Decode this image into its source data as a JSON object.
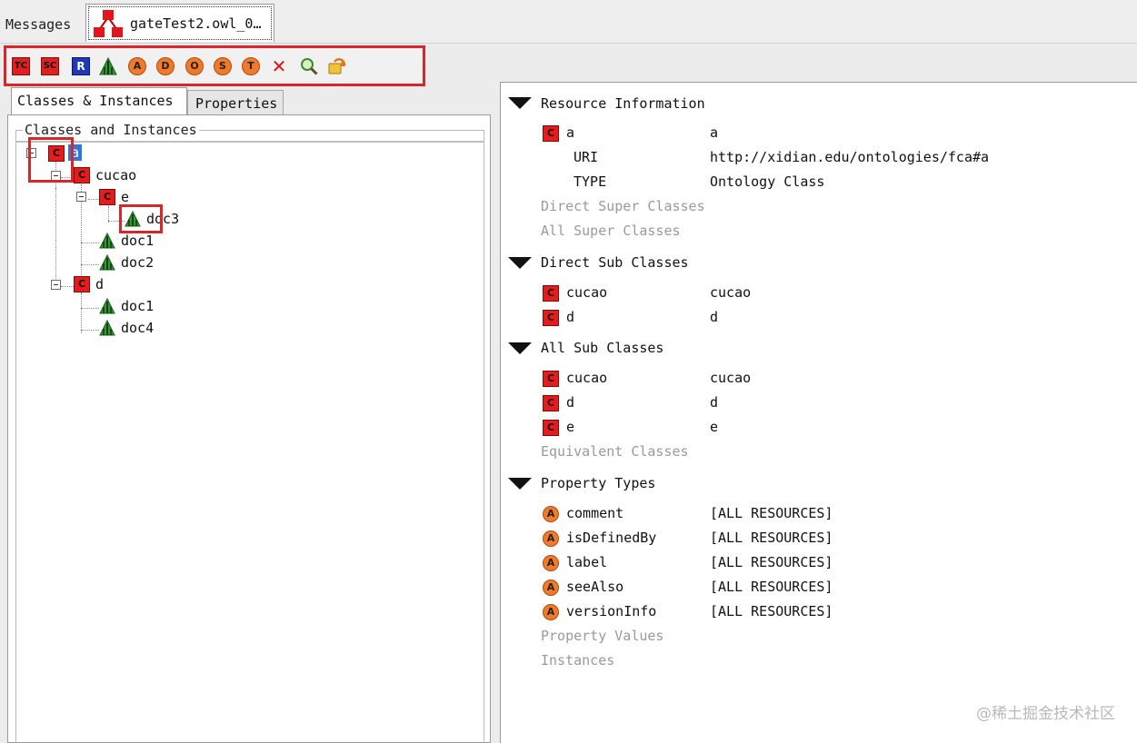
{
  "tabs": {
    "messages": "Messages",
    "gate": "gateTest2.owl_0…"
  },
  "toolbar": {
    "items": [
      {
        "name": "top-class-button",
        "glyph": "TC"
      },
      {
        "name": "sub-class-button",
        "glyph": "SC"
      },
      {
        "name": "restriction-button",
        "glyph": "R"
      },
      {
        "name": "instance-button",
        "glyph": ""
      },
      {
        "name": "annotation-property-button",
        "glyph": "A"
      },
      {
        "name": "datatype-property-button",
        "glyph": "D"
      },
      {
        "name": "object-property-button",
        "glyph": "O"
      },
      {
        "name": "symmetric-property-button",
        "glyph": "S"
      },
      {
        "name": "transitive-property-button",
        "glyph": "T"
      },
      {
        "name": "delete-button",
        "glyph": "✕"
      },
      {
        "name": "search-button",
        "glyph": ""
      },
      {
        "name": "refresh-button",
        "glyph": ""
      }
    ]
  },
  "left": {
    "tab_classes": "Classes & Instances",
    "tab_properties": "Properties",
    "group_title": "Classes and Instances",
    "tree": {
      "root": "a",
      "cucao": "cucao",
      "e": "e",
      "doc3": "doc3",
      "doc1a": "doc1",
      "doc2": "doc2",
      "d": "d",
      "doc1b": "doc1",
      "doc4": "doc4"
    }
  },
  "right": {
    "resource_info": {
      "title": "Resource Information",
      "name": "a",
      "name_val": "a",
      "uri_label": "URI",
      "uri_val": "http://xidian.edu/ontologies/fca#a",
      "type_label": "TYPE",
      "type_val": "Ontology Class",
      "direct_super": "Direct Super Classes",
      "all_super": "All Super Classes"
    },
    "direct_sub": {
      "title": "Direct Sub Classes",
      "rows": [
        {
          "name": "cucao",
          "val": "cucao"
        },
        {
          "name": "d",
          "val": "d"
        }
      ]
    },
    "all_sub": {
      "title": "All Sub Classes",
      "rows": [
        {
          "name": "cucao",
          "val": "cucao"
        },
        {
          "name": "d",
          "val": "d"
        },
        {
          "name": "e",
          "val": "e"
        }
      ],
      "equivalent": "Equivalent Classes"
    },
    "property_types": {
      "title": "Property Types",
      "rows": [
        {
          "name": "comment",
          "val": "[ALL RESOURCES]"
        },
        {
          "name": "isDefinedBy",
          "val": "[ALL RESOURCES]"
        },
        {
          "name": "label",
          "val": "[ALL RESOURCES]"
        },
        {
          "name": "seeAlso",
          "val": "[ALL RESOURCES]"
        },
        {
          "name": "versionInfo",
          "val": "[ALL RESOURCES]"
        }
      ],
      "property_values": "Property Values",
      "instances": "Instances"
    }
  },
  "icon_glyphs": {
    "class": "C",
    "annotation": "A"
  },
  "colors": {
    "highlight": "#d9262b",
    "class_icon": "#e41c1c",
    "annotation_icon": "#f07a2a",
    "selection": "#3377d6"
  },
  "watermark": "@稀土掘金技术社区"
}
